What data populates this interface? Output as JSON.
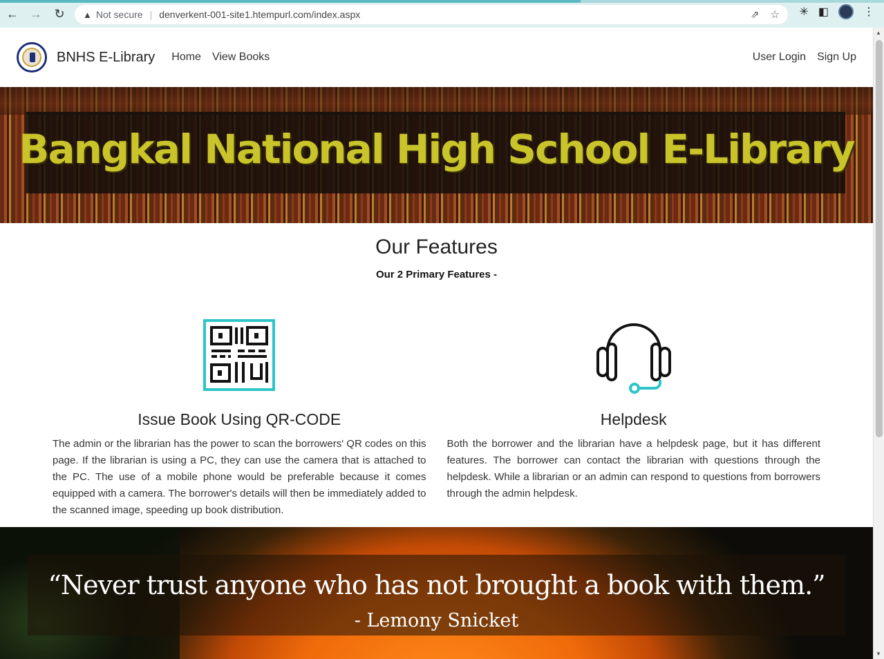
{
  "browser": {
    "security": "Not secure",
    "url": "denverkent-001-site1.htempurl.com/index.aspx"
  },
  "navbar": {
    "brand": "BNHS E-Library",
    "links": [
      "Home",
      "View Books"
    ],
    "right_links": [
      "User Login",
      "Sign Up"
    ]
  },
  "hero": {
    "title": "Bangkal National High School E-Library"
  },
  "features": {
    "heading": "Our Features",
    "subheading": "Our 2 Primary Features -",
    "items": [
      {
        "icon": "qr-code-icon",
        "title": "Issue Book Using QR-CODE",
        "text": "The admin or the librarian has the power to scan the borrowers' QR codes on this page. If the librarian is using a PC, they can use the camera that is attached to the PC. The use of a mobile phone would be preferable because it comes equipped with a camera. The borrower's details will then be immediately added to the scanned image, speeding up book distribution."
      },
      {
        "icon": "headset-icon",
        "title": "Helpdesk",
        "text": "Both the borrower and the librarian have a helpdesk page, but it has different features. The borrower can contact the librarian with questions through the helpdesk. While a librarian or an admin can respond to questions from borrowers through the admin helpdesk."
      }
    ]
  },
  "quote": {
    "text": "“Never trust anyone who has not brought a book with them.”",
    "author": "- Lemony Snicket"
  },
  "colors": {
    "accent": "#2ec4c8",
    "hero_title": "#c9c42a"
  }
}
